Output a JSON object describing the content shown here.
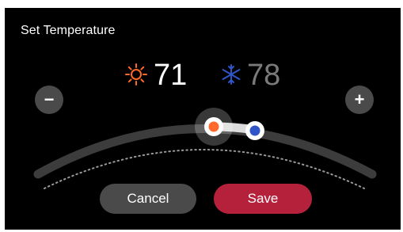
{
  "dialog": {
    "title": "Set Temperature"
  },
  "setpoints": {
    "heat": {
      "value": "71",
      "icon": "sun-icon",
      "color": "#ff6a2a"
    },
    "cool": {
      "value": "78",
      "icon": "snowflake-icon",
      "color": "#2f55c8",
      "text_color": "#7a7a7a"
    }
  },
  "controls": {
    "decrease_label": "−",
    "increase_label": "+"
  },
  "actions": {
    "cancel_label": "Cancel",
    "save_label": "Save"
  },
  "colors": {
    "background": "#000000",
    "button_gray": "#4a4a4a",
    "save_red": "#b5203b"
  }
}
